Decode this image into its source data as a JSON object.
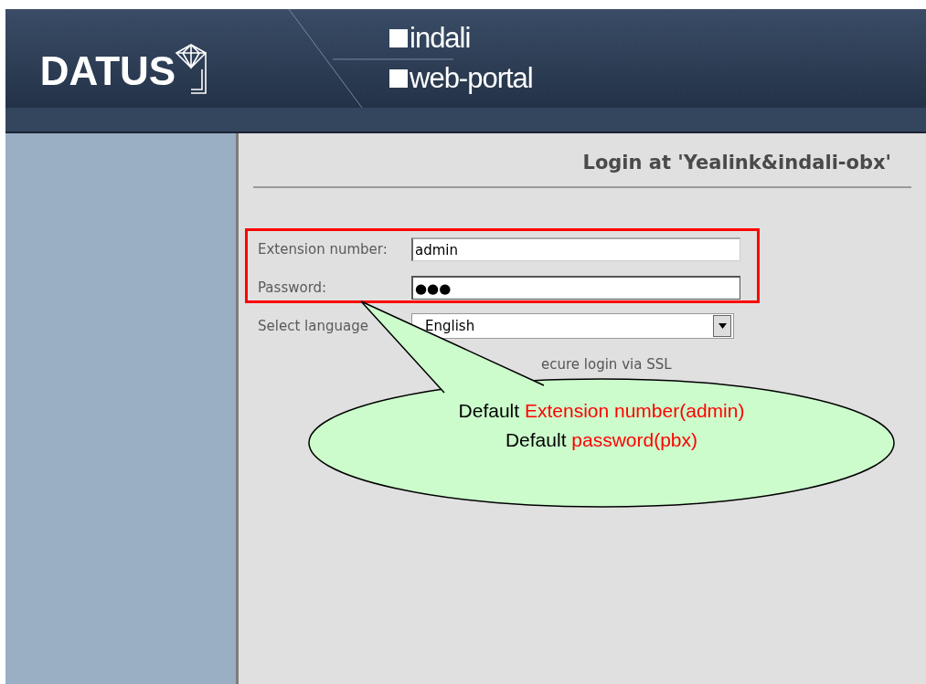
{
  "header": {
    "logo": "DATUS",
    "product": "indali",
    "portal": "web-portal"
  },
  "login": {
    "title": "Login at 'Yealink&indali-obx'",
    "fields": [
      {
        "kind": "text",
        "label": "Extension number:",
        "value": "admin"
      },
      {
        "kind": "text",
        "label": "Password:",
        "value": "●●●"
      },
      {
        "kind": "select",
        "label": "Select language",
        "value": "English"
      }
    ],
    "ssl": {
      "label": "ecure login via SSL"
    }
  },
  "callout": {
    "lines": [
      {
        "text": "Default",
        "highlight": "Extension number(admin)"
      },
      {
        "text": "Default",
        "highlight": "password(pbx)"
      }
    ]
  }
}
